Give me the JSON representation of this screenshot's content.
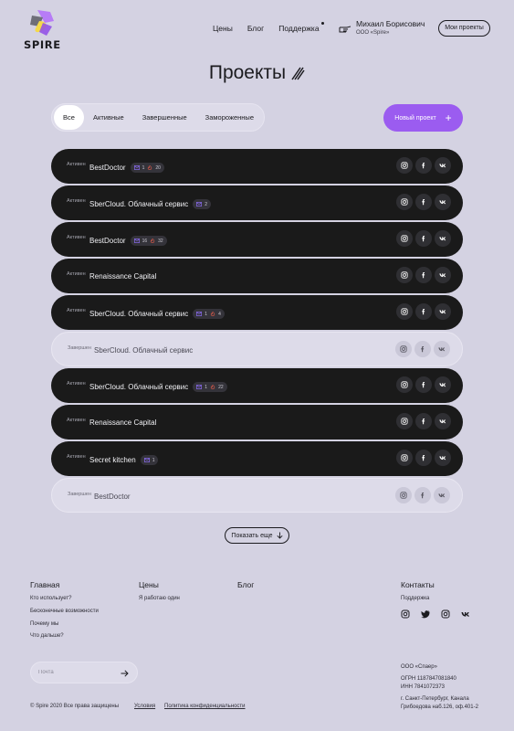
{
  "header": {
    "logo_text": "SPIRE",
    "nav": [
      "Цены",
      "Блог",
      "Поддержка"
    ],
    "user_name": "Михаил Борисович",
    "user_org": "ООО «Spire»",
    "my_projects": "Мои проекты"
  },
  "page": {
    "title": "Проекты"
  },
  "filters": {
    "tabs": [
      "Все",
      "Активные",
      "Завершенные",
      "Замороженные"
    ],
    "active": "Все",
    "new_project": "Новый проект"
  },
  "projects": [
    {
      "status": "Активен",
      "name": "BestDoctor",
      "done": false,
      "badges": [
        "1",
        "20"
      ]
    },
    {
      "status": "Активен",
      "name": "SberCloud. Облачный сервис",
      "done": false,
      "badges": [
        "2"
      ]
    },
    {
      "status": "Активен",
      "name": "BestDoctor",
      "done": false,
      "badges": [
        "16",
        "32"
      ]
    },
    {
      "status": "Активен",
      "name": "Renaissance Capital",
      "done": false,
      "badges": []
    },
    {
      "status": "Активен",
      "name": "SberCloud. Облачный сервис",
      "done": false,
      "badges": [
        "1",
        "4"
      ]
    },
    {
      "status": "Завершен",
      "name": "SberCloud. Облачный сервис",
      "done": true,
      "badges": []
    },
    {
      "status": "Активен",
      "name": "SberCloud. Облачный сервис",
      "done": false,
      "badges": [
        "1",
        "22"
      ]
    },
    {
      "status": "Активен",
      "name": "Renaissance Capital",
      "done": false,
      "badges": []
    },
    {
      "status": "Активен",
      "name": "Secret kitchen",
      "done": false,
      "badges": [
        "1"
      ]
    },
    {
      "status": "Завершен",
      "name": "BestDoctor",
      "done": true,
      "badges": []
    }
  ],
  "show_more": "Показать еще",
  "footer": {
    "col_main": {
      "title": "Главная",
      "links": [
        "Кто использует?",
        "Бесконечные возможности",
        "Почему мы",
        "Что дальше?"
      ]
    },
    "col_prices": {
      "title": "Цены",
      "links": [
        "Я работаю один"
      ]
    },
    "col_blog": {
      "title": "Блог"
    },
    "col_contacts": {
      "title": "Контакты",
      "links": [
        "Поддержка"
      ]
    },
    "subscribe_placeholder": "Почта",
    "company": [
      "ООО «Спаер»",
      "ОГРН 1187847081840",
      "ИНН 7841072373",
      "г. Санкт-Петербург, Канала",
      "Грибоедова наб.126, оф.401-2"
    ],
    "copyright": "© Spire 2020 Все права защищены",
    "terms": "Условия",
    "privacy": "Политика конфиденциальности"
  },
  "icons": {
    "badge_tasks": "mail-icon",
    "badge_alerts": "fire-icon"
  },
  "colors": {
    "accent": "#9b5cf0",
    "row_dark": "#1a1a1a",
    "background": "#d4d2e2"
  }
}
